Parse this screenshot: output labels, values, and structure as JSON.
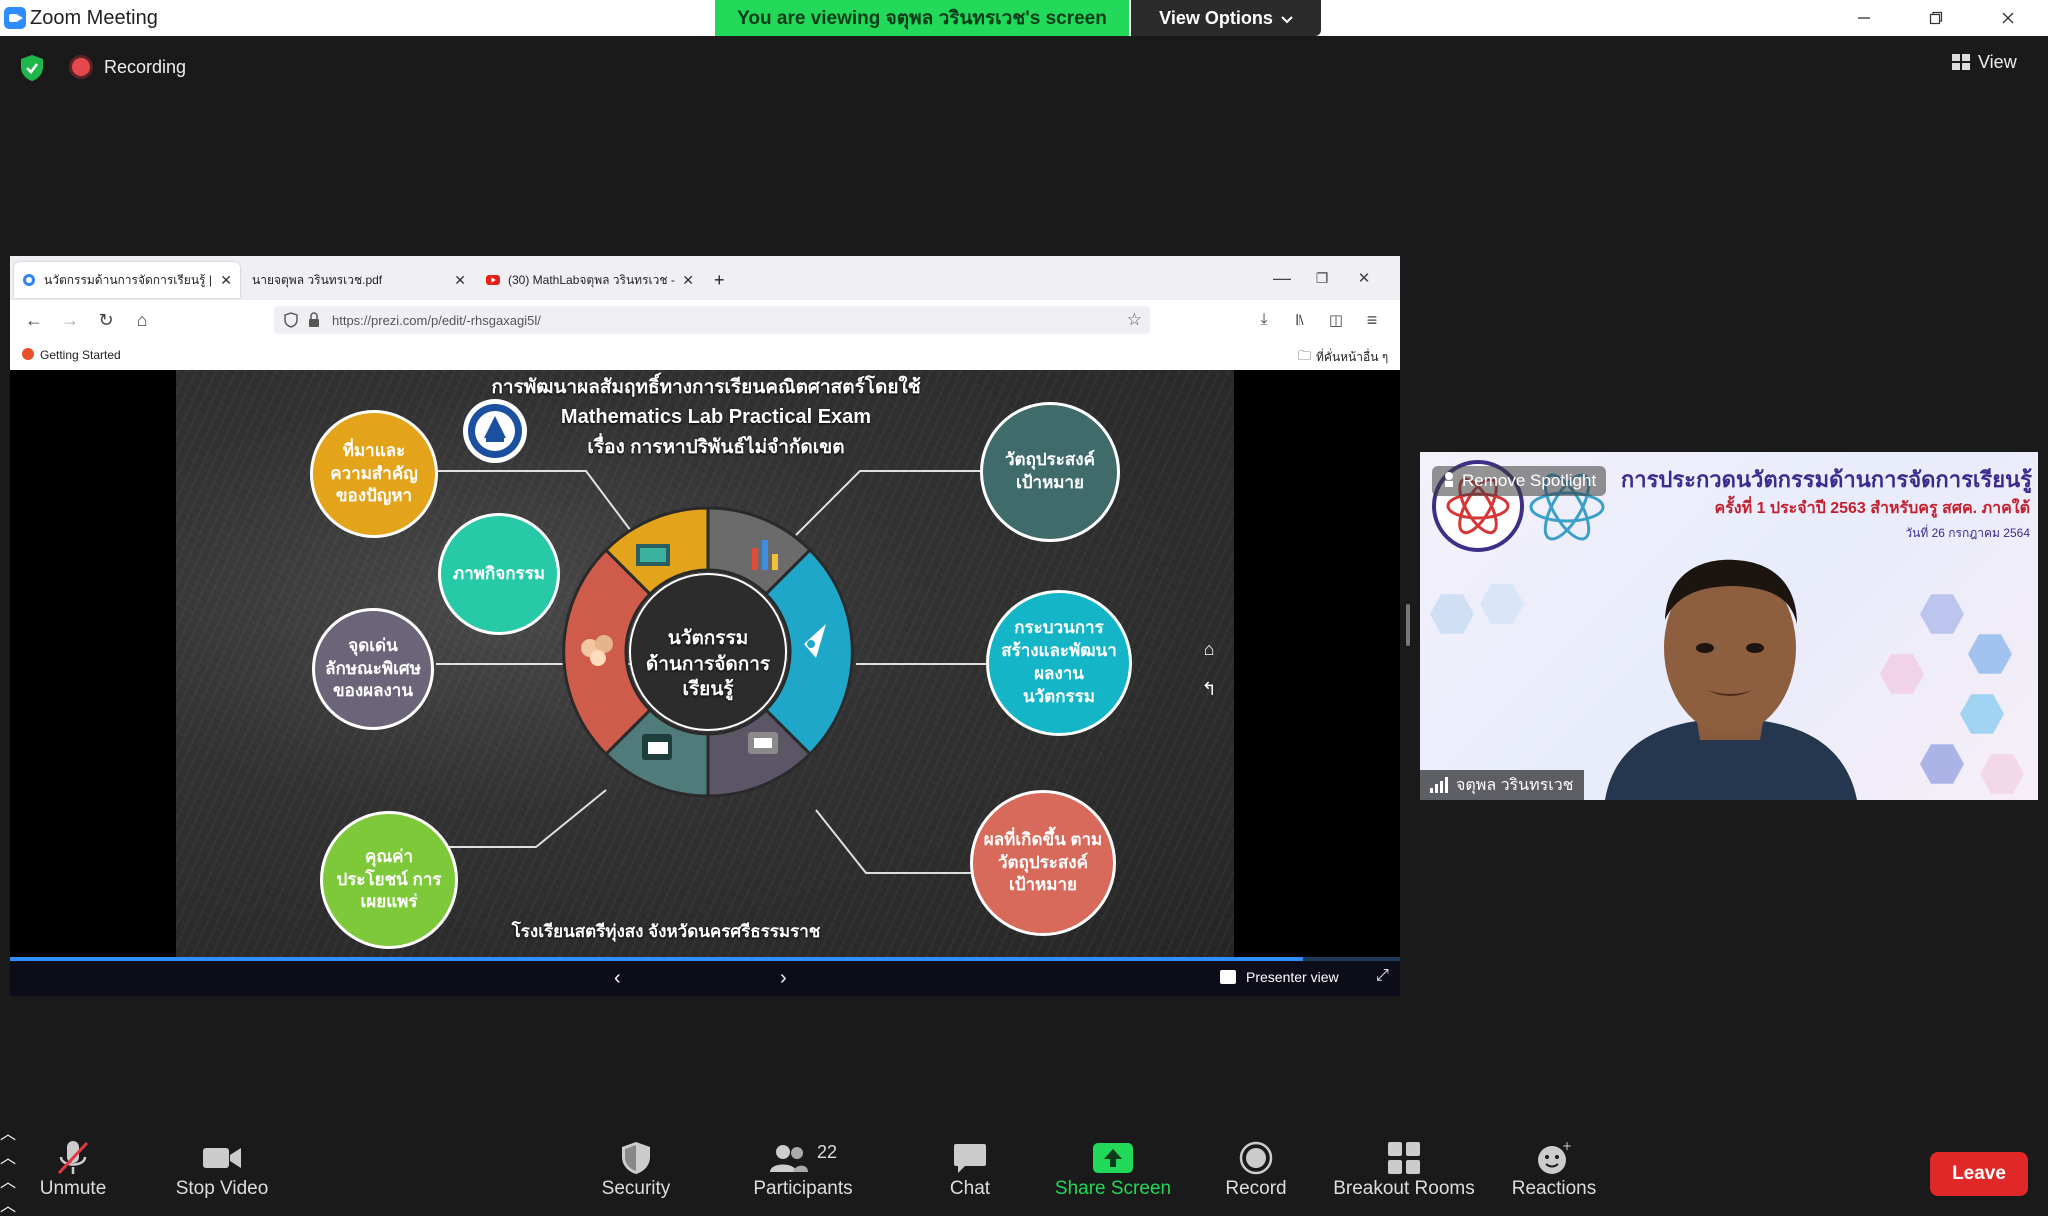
{
  "window": {
    "title": "Zoom Meeting",
    "viewing_banner": "You are viewing จตุพล วรินทรเวช's screen",
    "view_options": "View Options"
  },
  "meeting_bar": {
    "recording_label": "Recording",
    "view_label": "View"
  },
  "browser": {
    "tabs": [
      {
        "label": "นวัตกรรมด้านการจัดการเรียนรู้ | Pr"
      },
      {
        "label": "นายจตุพล วรินทรเวช.pdf"
      },
      {
        "label": "(30) MathLabจตุพล วรินทรเวช -"
      }
    ],
    "url": "https://prezi.com/p/edit/-rhsgaxagi5l/",
    "bookmark_left": "Getting Started",
    "bookmark_right": "ที่คั่นหน้าอื่น ๆ"
  },
  "slide": {
    "title_line1": "การพัฒนาผลสัมฤทธิ์ทางการเรียนคณิตศาสตร์โดยใช้",
    "title_line2": "Mathematics Lab Practical Exam",
    "title_line3": "เรื่อง การหาปริพันธ์ไม่จำกัดเขต",
    "center_line1": "นวัตกรรม",
    "center_line2": "ด้านการจัดการ",
    "center_line3": "เรียนรู้",
    "bubbles": [
      {
        "text": "ที่มาและ ความสำคัญ ของปัญหา",
        "color": "#e3a31a"
      },
      {
        "text": "ภาพกิจกรรม",
        "color": "#27c9a6"
      },
      {
        "text": "จุดเด่น ลักษณะพิเศษ ของผลงาน",
        "color": "#6c6478"
      },
      {
        "text": "คุณค่า ประโยชน์ การเผยแพร่",
        "color": "#7dc93a"
      },
      {
        "text": "วัตถุประสงค์ เป้าหมาย",
        "color": "#3f6b6b"
      },
      {
        "text": "กระบวนการ สร้างและพัฒนา ผลงาน นวัตกรรม",
        "color": "#14b5c7"
      },
      {
        "text": "ผลที่เกิดขึ้น ตามวัตถุประสงค์ เป้าหมาย",
        "color": "#d86a5b"
      }
    ],
    "footer": "โรงเรียนสตรีทุ่งสง จังหวัดนครศรีธรรมราช"
  },
  "prezi": {
    "presenter_view": "Presenter view",
    "progress_fraction": 0.93
  },
  "video": {
    "spotlight_label": "Remove Spotlight",
    "bg_title": "การประกวดนวัตกรรมด้านการจัดการเรียนรู้",
    "bg_subtitle": "ครั้งที่ 1 ประจำปี 2563 สำหรับครู สศค. ภาคใต้",
    "bg_date": "วันที่ 26 กรกฎาคม 2564",
    "participant_name": "จตุพล วรินทรเวช"
  },
  "toolbar": {
    "unmute": "Unmute",
    "stop_video": "Stop Video",
    "security": "Security",
    "participants": "Participants",
    "participants_count": "22",
    "chat": "Chat",
    "share_screen": "Share Screen",
    "record": "Record",
    "breakout_rooms": "Breakout Rooms",
    "reactions": "Reactions",
    "leave": "Leave"
  },
  "colors": {
    "banner_green": "#23d959",
    "leave_red": "#e02828",
    "share_green": "#23d959",
    "progress_blue": "#2f8fff"
  }
}
